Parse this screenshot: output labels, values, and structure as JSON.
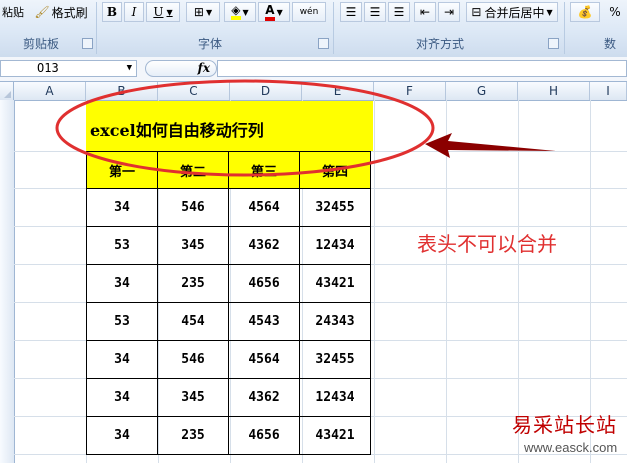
{
  "ribbon": {
    "clipboard": {
      "paste_label": "粘贴",
      "format_painter_label": "格式刷",
      "group_label": "剪贴板"
    },
    "font": {
      "bold": "B",
      "italic": "I",
      "underline": "U",
      "font_color_glyph": "A",
      "phonetic_label": "wén",
      "group_label": "字体"
    },
    "alignment": {
      "merge_center_label": "合并后居中",
      "group_label": "对齐方式"
    },
    "number": {
      "percent_label": "%",
      "group_label": "数"
    }
  },
  "formula_bar": {
    "name_box": "O13",
    "fx_label": "fx",
    "formula": ""
  },
  "columns": [
    "A",
    "B",
    "C",
    "D",
    "E",
    "F",
    "G",
    "H",
    "I"
  ],
  "sheet": {
    "title": "excel如何自由移动行列",
    "headers": [
      "第一",
      "第二",
      "第三",
      "第四"
    ],
    "rows": [
      [
        "34",
        "546",
        "4564",
        "32455"
      ],
      [
        "53",
        "345",
        "4362",
        "12434"
      ],
      [
        "34",
        "235",
        "4656",
        "43421"
      ],
      [
        "53",
        "454",
        "4543",
        "24343"
      ],
      [
        "34",
        "546",
        "4564",
        "32455"
      ],
      [
        "34",
        "345",
        "4362",
        "12434"
      ],
      [
        "34",
        "235",
        "4656",
        "43421"
      ]
    ]
  },
  "annotation": {
    "text": "表头不可以合并",
    "color": "#e03030"
  },
  "watermark": {
    "site_name": "易采站长站",
    "url": "www.easck.com"
  },
  "colors": {
    "highlight": "#ffff00",
    "annotation_ellipse": "#e03030",
    "arrow": "#8b0000"
  }
}
